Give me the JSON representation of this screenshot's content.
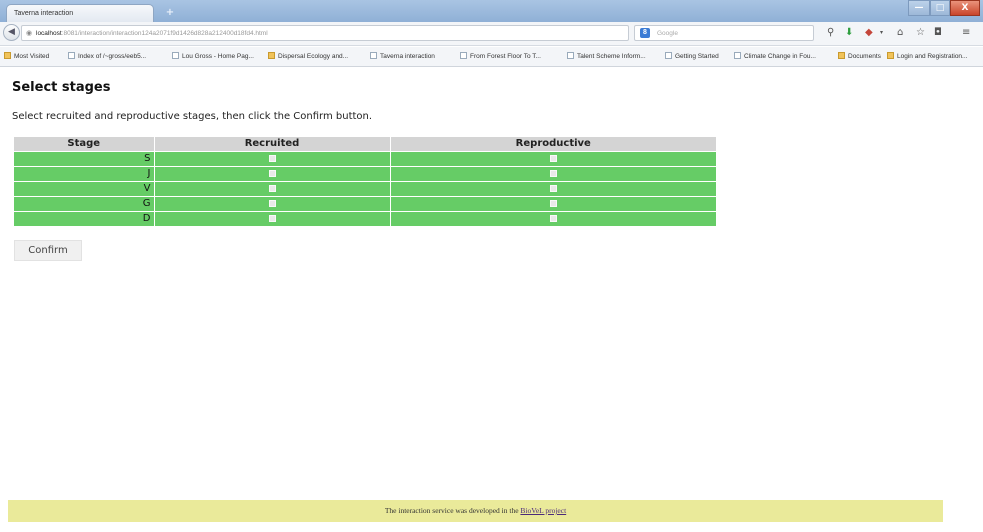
{
  "browser": {
    "tab_title": "Taverna interaction",
    "new_tab": "+",
    "url_host": "localhost",
    "url_path": ":8081/interaction/interaction124a2071f9d1426d828a212400d18fd4.html",
    "search_placeholder": "Google",
    "search_engine_letter": "8",
    "reload_symbol": "▾ C",
    "bookmarks": [
      {
        "label": "Most Visited"
      },
      {
        "label": "Index of /~gross/eeb5..."
      },
      {
        "label": "Lou Gross - Home Pag..."
      },
      {
        "label": "Dispersal Ecology and..."
      },
      {
        "label": "Taverna interaction"
      },
      {
        "label": "From Forest Floor To T..."
      },
      {
        "label": "Talent Scheme Inform..."
      },
      {
        "label": "Getting Started"
      },
      {
        "label": "Climate Change in Fou..."
      },
      {
        "label": "Documents"
      },
      {
        "label": "Login and Registration..."
      }
    ],
    "icons": [
      "search-icon",
      "download-icon",
      "extension-icon",
      "home-icon",
      "bookmark-star-icon",
      "pocket-icon",
      "menu-icon"
    ],
    "window_controls": {
      "minimize": "—",
      "maximize": "□",
      "close": "X"
    }
  },
  "page": {
    "heading": "Select stages",
    "instructions": "Select recruited and reproductive stages, then click the Confirm button.",
    "columns": [
      "Stage",
      "Recruited",
      "Reproductive"
    ],
    "rows": [
      {
        "stage": "S",
        "recruited": false,
        "reproductive": false
      },
      {
        "stage": "J",
        "recruited": false,
        "reproductive": false
      },
      {
        "stage": "V",
        "recruited": false,
        "reproductive": false
      },
      {
        "stage": "G",
        "recruited": false,
        "reproductive": false
      },
      {
        "stage": "D",
        "recruited": false,
        "reproductive": false
      }
    ],
    "confirm_label": "Confirm"
  },
  "footer": {
    "text": "The interaction service was developed in the",
    "link_text": "BioVeL project"
  },
  "colors": {
    "row_green": "#66cc66",
    "header_gray": "#d4d4d4",
    "footer_yellow": "#eaea9a"
  }
}
